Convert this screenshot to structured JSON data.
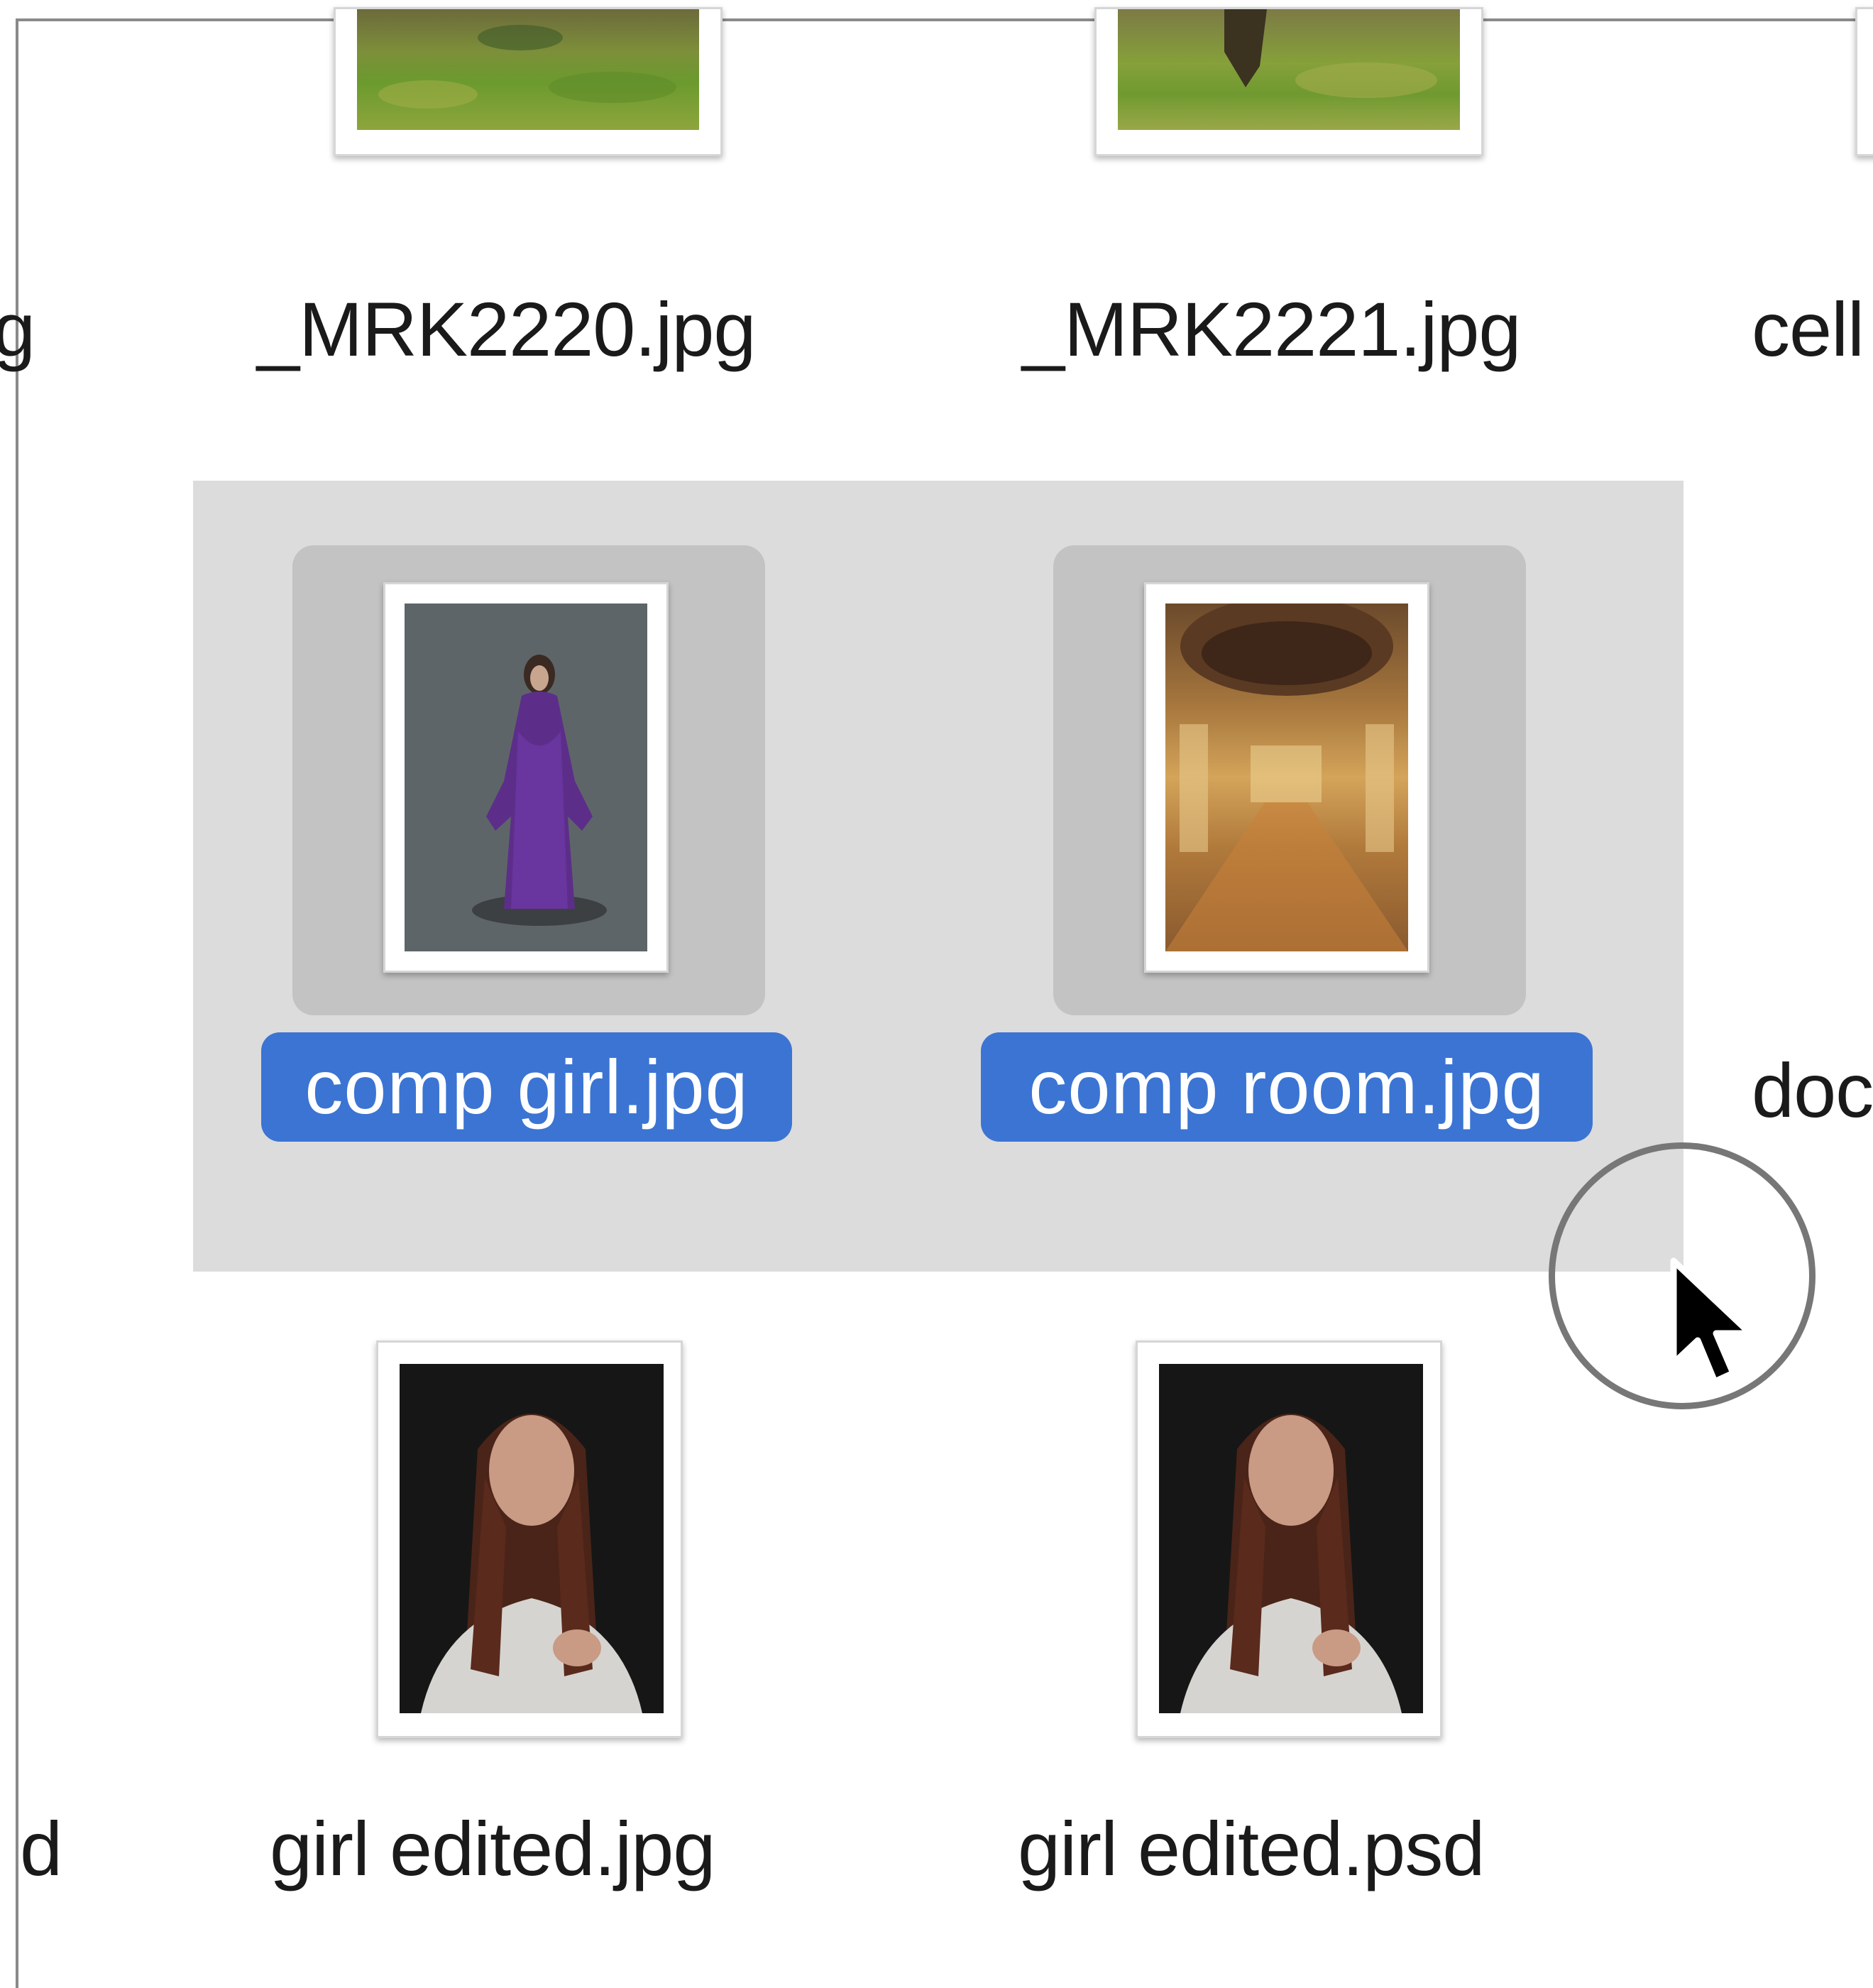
{
  "files": {
    "row1": [
      {
        "name": "_MRK2220.jpg",
        "selected": false
      },
      {
        "name": "_MRK2221.jpg",
        "selected": false
      },
      {
        "name": "cell",
        "selected": false
      }
    ],
    "row1_left_partial": "g",
    "row2": [
      {
        "name": "comp girl.jpg",
        "selected": true
      },
      {
        "name": "comp room.jpg",
        "selected": true
      },
      {
        "name": "doc",
        "selected": false
      }
    ],
    "row3": [
      {
        "name": "girl edited.jpg",
        "selected": false
      },
      {
        "name": "girl edited.psd",
        "selected": false
      }
    ],
    "row3_left_partial": "d"
  },
  "colors": {
    "selection_label": "#3b74d3",
    "marquee": "#dcdcdc",
    "selection_icon_bg": "#c3c3c3"
  },
  "icons": {
    "cursor": "arrow-pointer-icon",
    "click_indicator": "click-ring-icon"
  }
}
